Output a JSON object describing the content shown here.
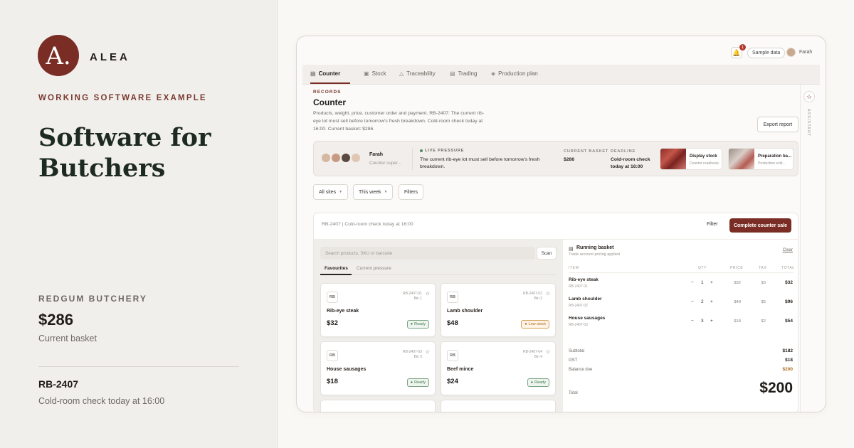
{
  "brand": {
    "logo_letter": "A.",
    "name": "ALEA"
  },
  "eyebrow": "WORKING SOFTWARE EXAMPLE",
  "hero_title": "Software for Butchers",
  "business": {
    "name": "REDGUM BUTCHERY",
    "basket_value": "$286",
    "basket_caption": "Current basket"
  },
  "reference": {
    "code": "RB-2407",
    "caption": "Cold-room check today at 16:00"
  },
  "app": {
    "topbar": {
      "notification_count": "1",
      "sample_label": "Sample data",
      "user_name": "Farah"
    },
    "tabs": [
      {
        "label": "Counter",
        "icon": "counter-icon",
        "active": true
      },
      {
        "label": "Stock",
        "icon": "box-icon"
      },
      {
        "label": "Traceability",
        "icon": "flask-icon"
      },
      {
        "label": "Trading",
        "icon": "store-icon"
      },
      {
        "label": "Production plan",
        "icon": "layers-icon"
      }
    ],
    "section_label": "RECORDS",
    "title": "Counter",
    "description": "Products, weight, price, customer order and payment. RB-2407: The current rib-eye lot must sell before tomorrow's fresh breakdown. Cold-room check today at 16:00. Current basket: $286.",
    "export_label": "Export report",
    "assistant_label": "ASSISTANT",
    "pressure": {
      "person_name": "Farah",
      "person_role": "Counter super...",
      "live_label": "LIVE PRESSURE",
      "live_text": "The current rib-eye lot must sell before tomorrow's fresh breakdown.",
      "basket_label": "CURRENT BASKET",
      "basket_value": "$286",
      "deadline_label": "DEADLINE",
      "deadline_value": "Cold-room check today at 16:00",
      "cards": [
        {
          "title": "Display stock",
          "subtitle": "Counter readiness"
        },
        {
          "title": "Preparation ba...",
          "subtitle": "Production evid..."
        }
      ]
    },
    "filters": {
      "site": "All sites",
      "period": "This week",
      "filters_label": "Filters"
    },
    "panel": {
      "header_text": "RB-2407 | Cold-room check today at 16:00",
      "filter_label": "Filter",
      "sale_label": "Complete counter sale",
      "search_placeholder": "Search products, SKU or barcode",
      "scan_label": "Scan",
      "subtabs": [
        "Favourites",
        "Current pressure"
      ],
      "products": [
        {
          "tag": "RB",
          "lot": "RB-2407-01",
          "bin": "Bin 1",
          "name": "Rib-eye steak",
          "price": "$32",
          "status": "Ready",
          "status_type": "ready"
        },
        {
          "tag": "RB",
          "lot": "RB-2407-02",
          "bin": "Bin 2",
          "name": "Lamb shoulder",
          "price": "$48",
          "status": "Low stock",
          "status_type": "low"
        },
        {
          "tag": "RB",
          "lot": "RB-2407-03",
          "bin": "Bin 3",
          "name": "House sausages",
          "price": "$18",
          "status": "Ready",
          "status_type": "ready"
        },
        {
          "tag": "RB",
          "lot": "RB-2407-04",
          "bin": "Bin 4",
          "name": "Beef mince",
          "price": "$24",
          "status": "Ready",
          "status_type": "ready"
        }
      ]
    },
    "basket": {
      "title": "Running basket",
      "subtitle": "Trade account pricing applied",
      "clear_label": "Clear",
      "headers": [
        "ITEM",
        "QTY",
        "PRICE",
        "TAX",
        "TOTAL"
      ],
      "items": [
        {
          "name": "Rib-eye steak",
          "lot": "RB-2407-01",
          "qty": "1",
          "price": "$32",
          "tax": "$3",
          "total": "$32"
        },
        {
          "name": "Lamb shoulder",
          "lot": "RB-2407-02",
          "qty": "2",
          "price": "$48",
          "tax": "$5",
          "total": "$96"
        },
        {
          "name": "House sausages",
          "lot": "RB-2407-03",
          "qty": "3",
          "price": "$18",
          "tax": "$2",
          "total": "$54"
        }
      ],
      "subtotal_label": "Subtotal",
      "subtotal": "$182",
      "gst_label": "GST",
      "gst": "$18",
      "balance_label": "Balance due",
      "balance": "$200",
      "total_label": "Total",
      "total": "$200"
    }
  },
  "colors": {
    "brand": "#7a2d24",
    "ready": "#3f7a4b",
    "low_stock": "#b06a1c"
  }
}
